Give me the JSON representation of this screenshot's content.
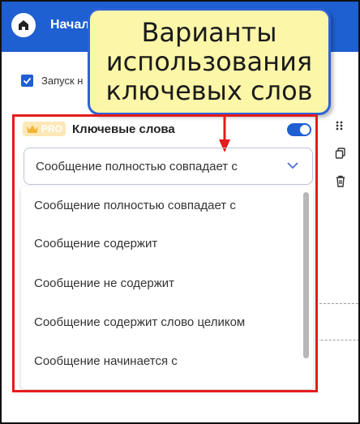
{
  "header": {
    "title": "Начал"
  },
  "start": {
    "label": "Запуск н"
  },
  "callout": {
    "lines": [
      "Варианты",
      "использования",
      "ключевых слов"
    ]
  },
  "card": {
    "pro_label": "PRO",
    "title": "Ключевые слова",
    "toggle_on": true
  },
  "select": {
    "value": "Сообщение полностью совпадает с"
  },
  "dropdown": {
    "options": [
      "Сообщение полностью совпадает с",
      "Сообщение содержит",
      "Сообщение не содержит",
      "Сообщение содержит слово целиком",
      "Сообщение начинается с"
    ]
  },
  "colors": {
    "brand": "#1e5fd1",
    "highlight": "#e31c1c",
    "callout_bg": "#fbf6a8"
  },
  "icons": {
    "home": "home-icon",
    "drag": "drag-handle-icon",
    "copy": "copy-icon",
    "delete": "trash-icon",
    "crown": "crown-icon",
    "chevron": "chevron-down-icon"
  }
}
